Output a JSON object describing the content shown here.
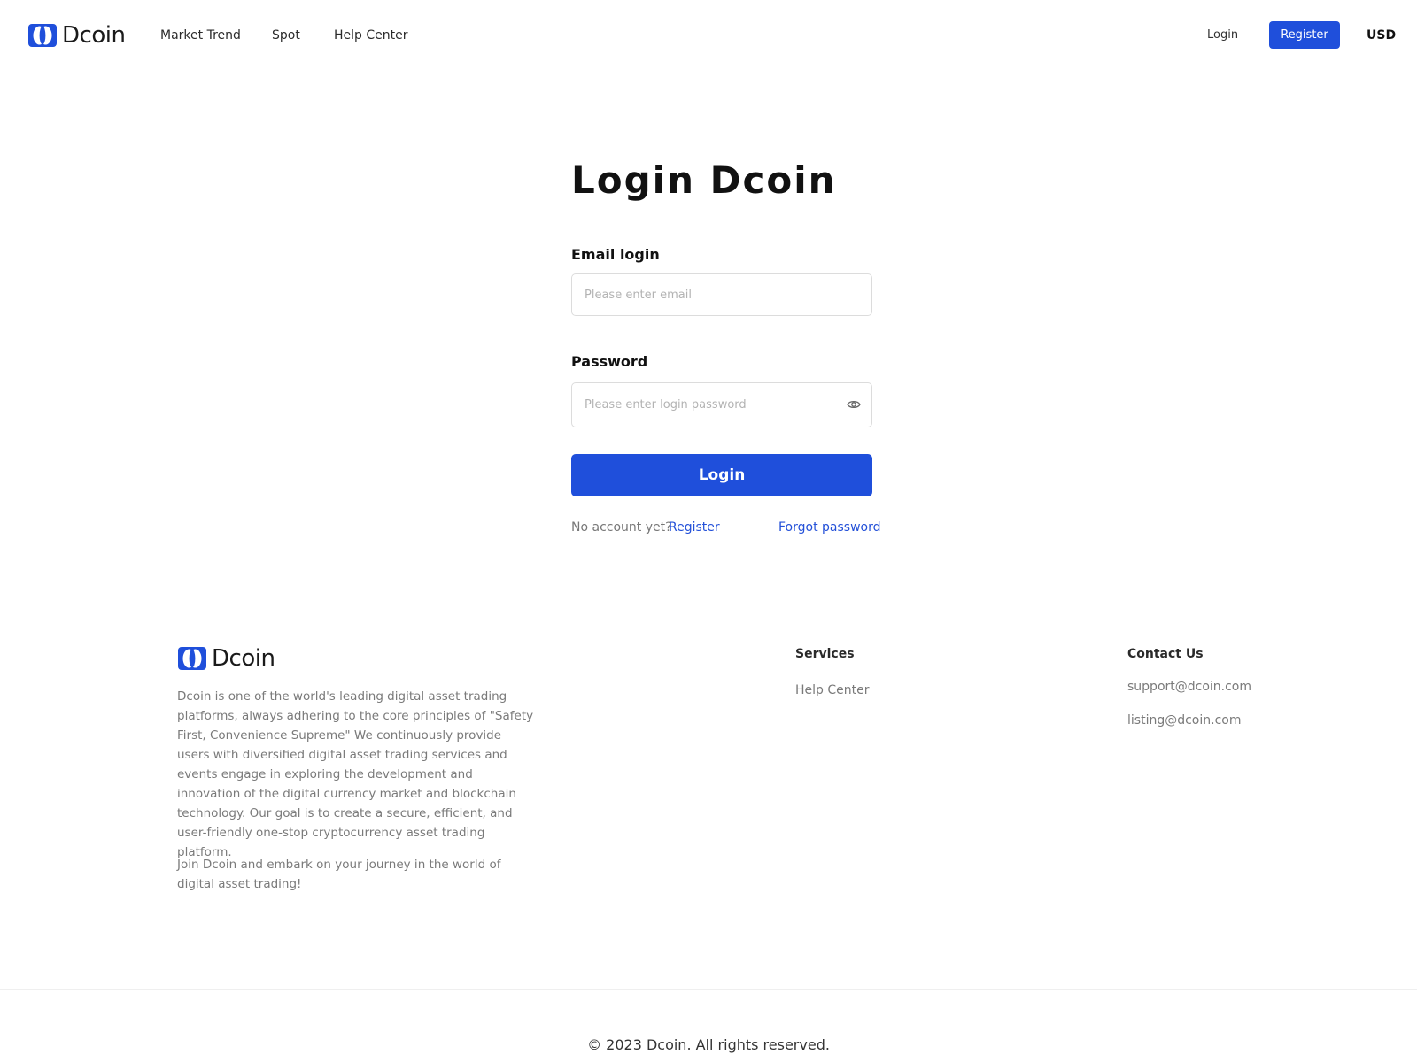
{
  "brand": {
    "name": "Dcoin",
    "colors": {
      "primary": "#1f4fdb",
      "link": "#2350d8"
    }
  },
  "header": {
    "nav": [
      {
        "label": "Market Trend"
      },
      {
        "label": "Spot"
      },
      {
        "label": "Help Center"
      }
    ],
    "login_label": "Login",
    "register_label": "Register",
    "currency": "USD"
  },
  "login": {
    "title": "Login Dcoin",
    "email_label": "Email login",
    "email_placeholder": "Please enter email",
    "email_value": "",
    "password_label": "Password",
    "password_placeholder": "Please enter login password",
    "password_value": "",
    "submit_label": "Login",
    "no_account_text": "No account yet?",
    "register_link": "Register",
    "forgot_link": "Forgot password"
  },
  "footer": {
    "description": "Dcoin is one of the world's leading digital asset trading platforms, always adhering to the core principles of \"Safety First, Convenience Supreme\" We continuously provide users with diversified digital asset trading services and events engage in exploring the development and innovation of the digital currency market and blockchain technology. Our goal is to create a secure, efficient, and user-friendly one-stop cryptocurrency asset trading platform.",
    "tagline": "Join Dcoin and embark on your journey in the world of digital asset trading!",
    "services_heading": "Services",
    "services_links": [
      "Help Center"
    ],
    "contact_heading": "Contact Us",
    "contact_emails": [
      "support@dcoin.com",
      "listing@dcoin.com"
    ],
    "copyright": "© 2023 Dcoin. All rights reserved."
  }
}
